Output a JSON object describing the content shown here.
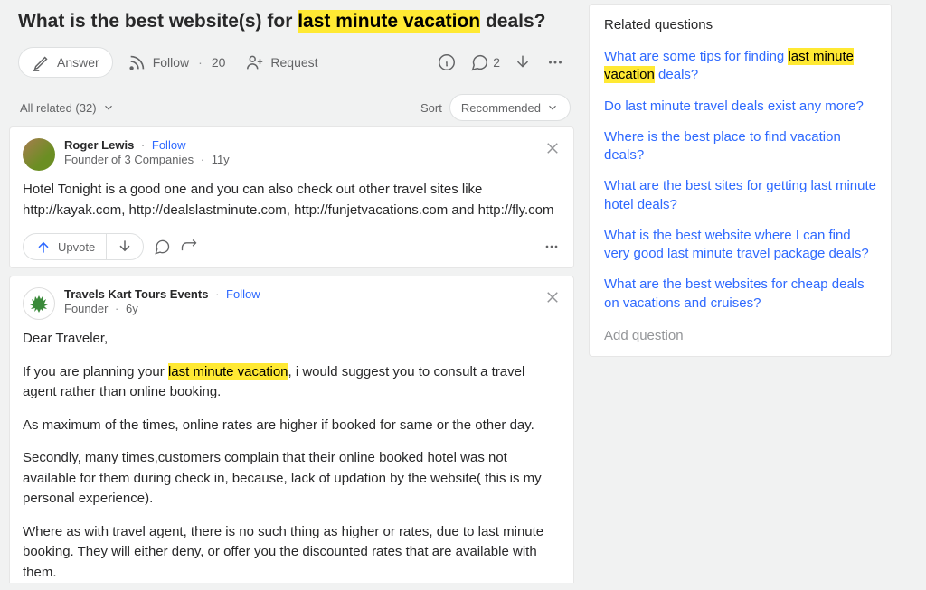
{
  "question": {
    "title_pre": "What is the best website(s) for ",
    "title_hl": "last minute vacation",
    "title_post": " deals?"
  },
  "actions": {
    "answer": "Answer",
    "follow": "Follow",
    "follow_count": "20",
    "request": "Request",
    "comments_count": "2"
  },
  "filter": {
    "all_related_label": "All related (32)",
    "sort_label": "Sort",
    "sort_value": "Recommended"
  },
  "answers": [
    {
      "author": "Roger Lewis",
      "follow": "Follow",
      "credential": "Founder of 3 Companies",
      "time": "11y",
      "body": "Hotel Tonight is a good one and you can also check out other travel sites like http://kayak.com, http://dealslastminute.com, http://funjetvacations.com and http://fly.com",
      "upvote": "Upvote"
    },
    {
      "author": "Travels Kart Tours Events",
      "follow": "Follow",
      "credential": "Founder",
      "time": "6y",
      "greeting": "Dear Traveler,",
      "p2_pre": "If you are planning your ",
      "p2_hl": "last minute vacation",
      "p2_post": ", i would suggest you to consult a travel agent rather than online booking.",
      "p3": "As maximum of the times, online rates are higher if booked for same or the other day.",
      "p4": "Secondly, many times,customers complain that their online booked hotel was not available for them during check in, because, lack of updation by the website( this is my personal experience).",
      "p5": "Where as with travel agent, there is no such thing as higher or rates, due to last minute booking. They will either deny, or offer you the discounted rates that are available with them."
    }
  ],
  "sidebar": {
    "title": "Related questions",
    "items": [
      {
        "pre": "What are some tips for finding ",
        "hl": "last minute vacation",
        "post": " deals?"
      },
      {
        "pre": "Do last minute travel deals exist any more?",
        "hl": "",
        "post": ""
      },
      {
        "pre": "Where is the best place to find vacation deals?",
        "hl": "",
        "post": ""
      },
      {
        "pre": "What are the best sites for getting last minute hotel deals?",
        "hl": "",
        "post": ""
      },
      {
        "pre": "What is the best website where I can find very good last minute travel package deals?",
        "hl": "",
        "post": ""
      },
      {
        "pre": "What are the best websites for cheap deals on vacations and cruises?",
        "hl": "",
        "post": ""
      }
    ],
    "add": "Add question"
  }
}
